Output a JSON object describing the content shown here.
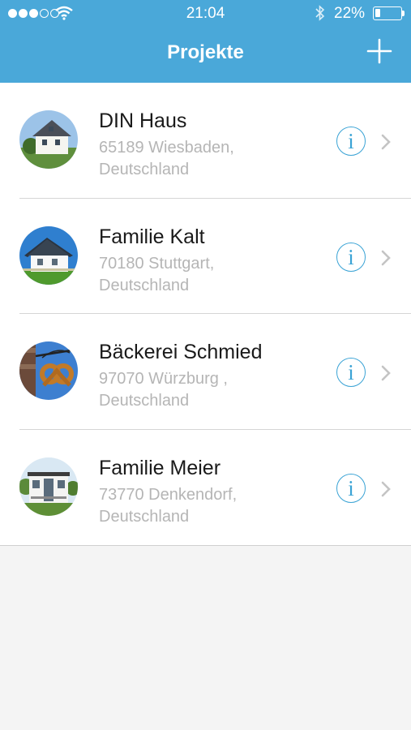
{
  "status_bar": {
    "time": "21:04",
    "battery_percent": "22%",
    "battery_level": 0.22,
    "signal_bars_filled": 3,
    "signal_bars_total": 5,
    "icons": [
      "signal-dots-icon",
      "wifi-icon",
      "bluetooth-icon",
      "battery-icon"
    ]
  },
  "nav": {
    "title": "Projekte",
    "add_icon": "plus-icon"
  },
  "colors": {
    "header_bg": "#4aa8d9",
    "accent": "#3aa3d5",
    "subtitle": "#b5b5b5",
    "background": "#f4f4f4"
  },
  "projects": [
    {
      "name": "DIN Haus",
      "address_line1": "65189 Wiesbaden,",
      "address_line2": "Deutschland",
      "thumbnail": "house-white-photo"
    },
    {
      "name": "Familie Kalt",
      "address_line1": "70180 Stuttgart,",
      "address_line2": "Deutschland",
      "thumbnail": "house-blue-roof-photo"
    },
    {
      "name": "Bäckerei Schmied",
      "address_line1": "97070 Würzburg ,",
      "address_line2": "Deutschland",
      "thumbnail": "bakery-pretzel-sign-photo"
    },
    {
      "name": "Familie Meier",
      "address_line1": "73770 Denkendorf,",
      "address_line2": "Deutschland",
      "thumbnail": "modern-house-photo"
    }
  ],
  "row_actions": {
    "info_icon": "info-icon",
    "disclosure_icon": "chevron-right-icon"
  }
}
